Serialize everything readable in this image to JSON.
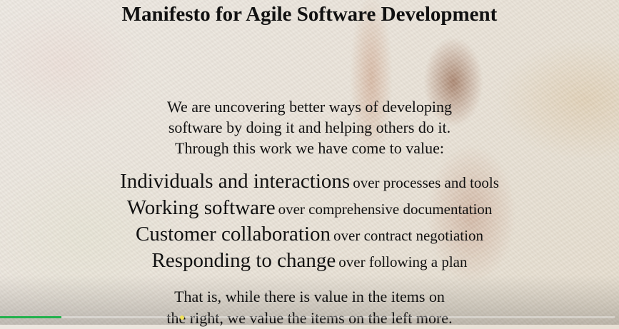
{
  "slide": {
    "title": "Manifesto for Agile Software Development",
    "intro": [
      "We are uncovering better ways of developing",
      "software by doing it and helping others do it.",
      "Through this work we have come to value:"
    ],
    "values": [
      {
        "main": "Individuals and interactions",
        "rest": "over processes and tools"
      },
      {
        "main": "Working software",
        "rest": "over comprehensive documentation"
      },
      {
        "main": "Customer collaboration",
        "rest": "over contract negotiation"
      },
      {
        "main": "Responding to change",
        "rest": "over following a plan"
      }
    ],
    "conclusion": [
      "That is, while there is value in the items on",
      "the right, we value the items on the left more."
    ]
  },
  "player": {
    "progress_fraction": 0.1,
    "played_color": "#22b14c"
  }
}
